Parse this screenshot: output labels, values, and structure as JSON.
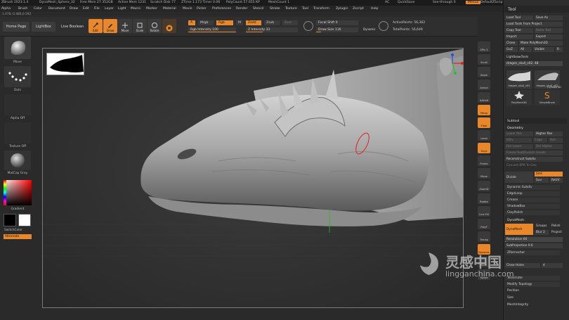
{
  "titlebar": {
    "app": "ZBrush 2023.1.4",
    "file": "DynaMesh_Sphere_32",
    "free_mem": "Free Mem 27.352GB",
    "active_mem": "Active Mem 1231",
    "scratch": "Scratch Disk 77",
    "ztime": "ZTime 1.173 Timer 0.06",
    "polycount": "PolyCount 57.655 KP",
    "meshcount": "MeshCount 1",
    "ac": "AC",
    "quicksave": "QuickSave",
    "seethrough": "See-through 0",
    "menus": "Menus",
    "defaultzscript": "DefaultZScript"
  },
  "menubar": [
    "Alpha",
    "Brush",
    "Color",
    "Document",
    "Draw",
    "Edit",
    "File",
    "Layer",
    "Light",
    "Macro",
    "Marker",
    "Material",
    "Movie",
    "Picker",
    "Preferences",
    "Render",
    "Stencil",
    "Stroke",
    "Texture",
    "Tool",
    "Transform",
    "Zplugin",
    "Zscript",
    "Help"
  ],
  "coords": "1.078,-0.486,0.592",
  "toolshelf": {
    "home_page": "Home Page",
    "lightbox": "LightBox",
    "live_boolean": "Live Boolean",
    "modes": [
      "Edit",
      "Draw",
      "Move",
      "Scale",
      "Rotate"
    ],
    "a_label": "A",
    "mrgb": "Mrgb",
    "rgb": "Rgb",
    "m": "M",
    "zadd": "Zadd",
    "zsub": "Zsub",
    "zcut": "Zcut",
    "rgb_intensity": "Rgb Intensity 100",
    "rgb_intensity_value": 100,
    "z_intensity": "Z Intensity 33",
    "z_intensity_value": 33,
    "focal_shift": "Focal Shift 0",
    "focal_shift_value": 0,
    "draw_size": "Draw Size 116",
    "draw_size_value": 116,
    "dynamic": "Dynamic",
    "active_points": "ActivePoints: 56,362",
    "total_points": "TotalPoints: 56,649"
  },
  "leftshelf": {
    "brush": "Move",
    "stroke": "Dots",
    "alpha": "Alpha Off",
    "texture": "Texture Off",
    "material": "MatCap Gray",
    "gradient": "Gradient",
    "switchcolor": "SwitchColor",
    "alternate": "Alternate"
  },
  "rightshelf": [
    "SPix 3",
    "Scroll",
    "Zoom",
    "Actual",
    "AAHalf",
    "Persp",
    "Floor",
    "Local",
    "Gxyz",
    "Frame",
    "Move",
    "ZoomD",
    "Rotate",
    "Line Fill",
    "PolyF",
    "Transp",
    "Dynamic",
    "Solo",
    "Xpose"
  ],
  "tool": {
    "title": "Tool",
    "load_tool": "Load Tool",
    "save_as": "Save As",
    "load_tools_from_project": "Load Tools From Project",
    "copy_tool": "Copy Tool",
    "paste_tool": "Paste Tool",
    "import": "Import",
    "export": "Export",
    "clone": "Clone",
    "make_polymesh3d": "Make PolyMesh3D",
    "goz": "GoZ",
    "all": "All",
    "visible": "Visible",
    "r": "R",
    "lightbox_tools": "Lightbox▸Tools",
    "current_tool": "dragon_skull_v02. 48",
    "thumb1": "dragon_skull_v02",
    "thumb2": "dragon_skull_v02",
    "thumb3": "Cylinder3D",
    "thumb4": "PolyMesh3D",
    "thumb5": "SimpleBrush",
    "subtool": "Subtool",
    "geometry": "Geometry",
    "lower_res": "Lower Res",
    "higher_res": "Higher Res",
    "sdiv": "SDiv",
    "cage": "Cage",
    "rstr": "Rstr",
    "del_lower": "Del Lower",
    "del_higher": "Del Higher",
    "freeze_subdiv": "Freeze SubDivision Levels",
    "reconstruct_subdiv": "Reconstruct Subdiv",
    "convert_bpr": "Convert BPR To Geo",
    "divide": "Divide",
    "smt": "Smt",
    "suv": "Suv",
    "reuv": "ReUV",
    "dynamic_subdiv": "Dynamic Subdiv",
    "edgeloop": "EdgeLoop",
    "crease": "Crease",
    "shadowbox": "ShadowBox",
    "claypolish": "ClayPolish",
    "dynamesh_sec": "DynaMesh",
    "dynamesh_btn": "DynaMesh",
    "groups": "Groups",
    "polish": "Polish",
    "blur": "Blur 2",
    "project": "Project",
    "resolution": "Resolution 64",
    "resolution_value": 64,
    "subproject": "SubProjection 0.6",
    "zremesher": "ZRemesher",
    "close_holes": "Close Holes",
    "val4": "4",
    "tessimate": "Tessimate",
    "modify_topology": "Modify Topology",
    "position": "Position",
    "size": "Size",
    "meshintegrity": "MeshIntegrity"
  },
  "watermark": {
    "cn": "灵感中国",
    "en": "lingganchina.com"
  },
  "colors": {
    "accent": "#e8882b",
    "panel": "#2d2d2d",
    "canvas": "#333333",
    "gizmo_red": "#e02020",
    "gizmo_green": "#22c022",
    "gizmo_blue": "#2a4be8"
  }
}
